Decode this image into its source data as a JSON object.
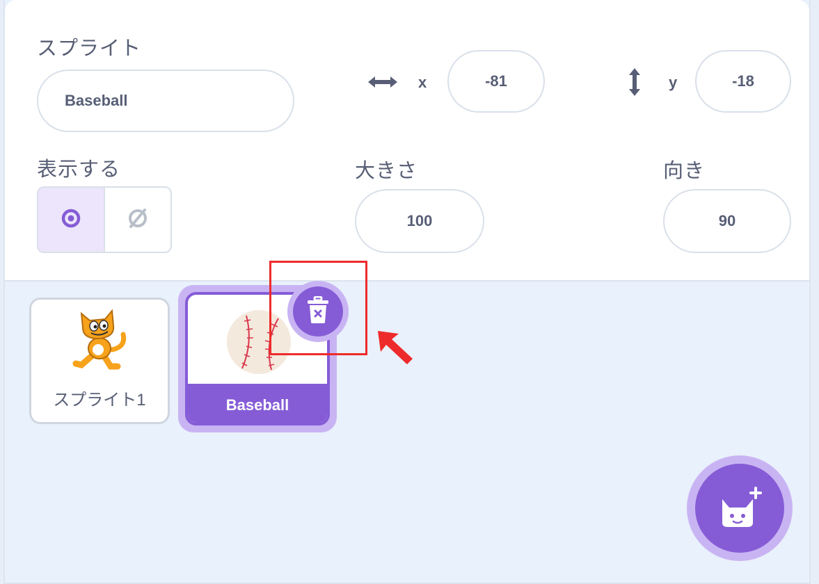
{
  "sprite_info": {
    "sprite_label": "スプライト",
    "sprite_name": "Baseball",
    "x_label": "x",
    "x_value": "-81",
    "y_label": "y",
    "y_value": "-18",
    "show_label": "表示する",
    "size_label": "大きさ",
    "size_value": "100",
    "direction_label": "向き",
    "direction_value": "90"
  },
  "sprites": [
    {
      "name": "スプライト1",
      "selected": false
    },
    {
      "name": "Baseball",
      "selected": true
    }
  ],
  "colors": {
    "accent": "#855cd6",
    "accent_light": "#c9b4f3",
    "annotation_red": "#ee2b2b",
    "text": "#575e75"
  }
}
